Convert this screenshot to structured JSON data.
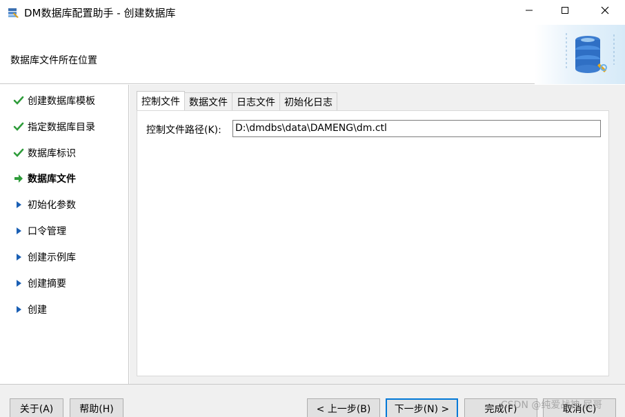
{
  "window": {
    "title": "DM数据库配置助手 - 创建数据库",
    "icon": "db-config-app-icon",
    "controls": {
      "minimize": "minimize-icon",
      "maximize": "maximize-icon",
      "close": "close-icon"
    }
  },
  "header": {
    "title": "数据库文件所在位置",
    "art": "database-gear-illustration"
  },
  "nav": {
    "items": [
      {
        "label": "创建数据库模板",
        "status": "done",
        "icon": "checkmark-icon"
      },
      {
        "label": "指定数据库目录",
        "status": "done",
        "icon": "checkmark-icon"
      },
      {
        "label": "数据库标识",
        "status": "done",
        "icon": "checkmark-icon"
      },
      {
        "label": "数据库文件",
        "status": "current",
        "icon": "arrow-right-icon"
      },
      {
        "label": "初始化参数",
        "status": "pending",
        "icon": "triangle-right-icon"
      },
      {
        "label": "口令管理",
        "status": "pending",
        "icon": "triangle-right-icon"
      },
      {
        "label": "创建示例库",
        "status": "pending",
        "icon": "triangle-right-icon"
      },
      {
        "label": "创建摘要",
        "status": "pending",
        "icon": "triangle-right-icon"
      },
      {
        "label": "创建",
        "status": "pending",
        "icon": "triangle-right-icon"
      }
    ]
  },
  "tabs": [
    {
      "label": "控制文件",
      "active": true
    },
    {
      "label": "数据文件",
      "active": false
    },
    {
      "label": "日志文件",
      "active": false
    },
    {
      "label": "初始化日志",
      "active": false
    }
  ],
  "control_file": {
    "path_label": "控制文件路径(K):",
    "path_value": "D:\\dmdbs\\data\\DAMENG\\dm.ctl"
  },
  "footer": {
    "about": "关于(A)",
    "help": "帮助(H)",
    "prev": "< 上一步(B)",
    "next": "下一步(N) >",
    "finish": "完成(F)",
    "cancel": "取消(C)",
    "watermark": "CSDN @纯爱战神 屁哥"
  },
  "colors": {
    "done": "#2e9c3a",
    "current": "#2e9c3a",
    "pending": "#1a5fb4",
    "focus_border": "#0078d7"
  }
}
